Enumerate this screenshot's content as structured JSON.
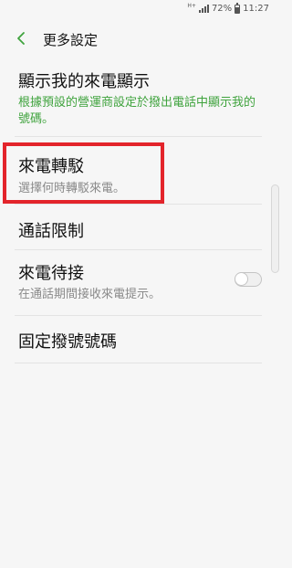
{
  "status_bar": {
    "network": "H+",
    "battery": "72%",
    "time": "11:27"
  },
  "header": {
    "title": "更多設定"
  },
  "settings": [
    {
      "title": "顯示我的來電顯示",
      "subtitle": "根據預設的營運商設定於撥出電話中顯示我的號碼。"
    },
    {
      "title": "來電轉駁",
      "subtitle": "選擇何時轉駁來電。"
    },
    {
      "title": "通話限制"
    },
    {
      "title": "來電待接",
      "subtitle": "在通話期間接收來電提示。",
      "toggle_on": false
    },
    {
      "title": "固定撥號號碼"
    }
  ],
  "colors": {
    "accent": "#3fa33d",
    "highlight": "#e3242b"
  }
}
